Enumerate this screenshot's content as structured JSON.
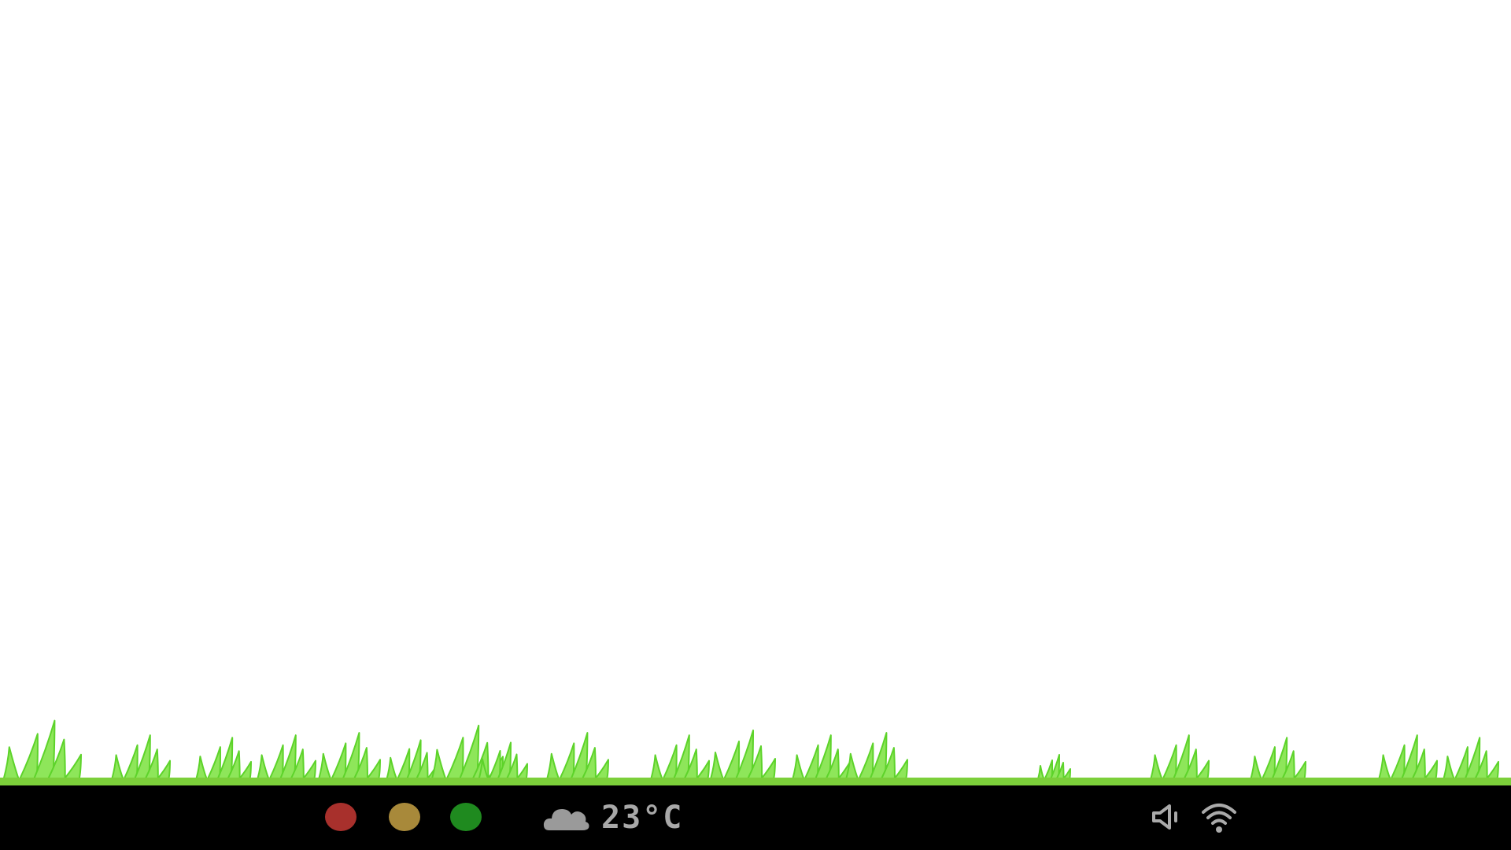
{
  "theme": {
    "desktop_bg": "#ffffff",
    "taskbar_bg": "#000000",
    "grass_fill": "#8ee65a",
    "grass_stroke": "#5dd32a",
    "ground_line": "#7ccf3a",
    "tray_icon_color": "#aaaaaa"
  },
  "taskbar": {
    "window_buttons": [
      {
        "name": "red-dot-button",
        "color": "#a8302c"
      },
      {
        "name": "amber-dot-button",
        "color": "#a8893a"
      },
      {
        "name": "green-dot-button",
        "color": "#1f8a1f"
      }
    ],
    "weather": {
      "icon": "cloud-icon",
      "icon_color": "#9a9a9a",
      "temperature": "23°C",
      "text_color": "#a8a8a8"
    },
    "tray": {
      "volume_icon": "speaker-muted-icon",
      "wifi_icon": "wifi-icon"
    }
  }
}
